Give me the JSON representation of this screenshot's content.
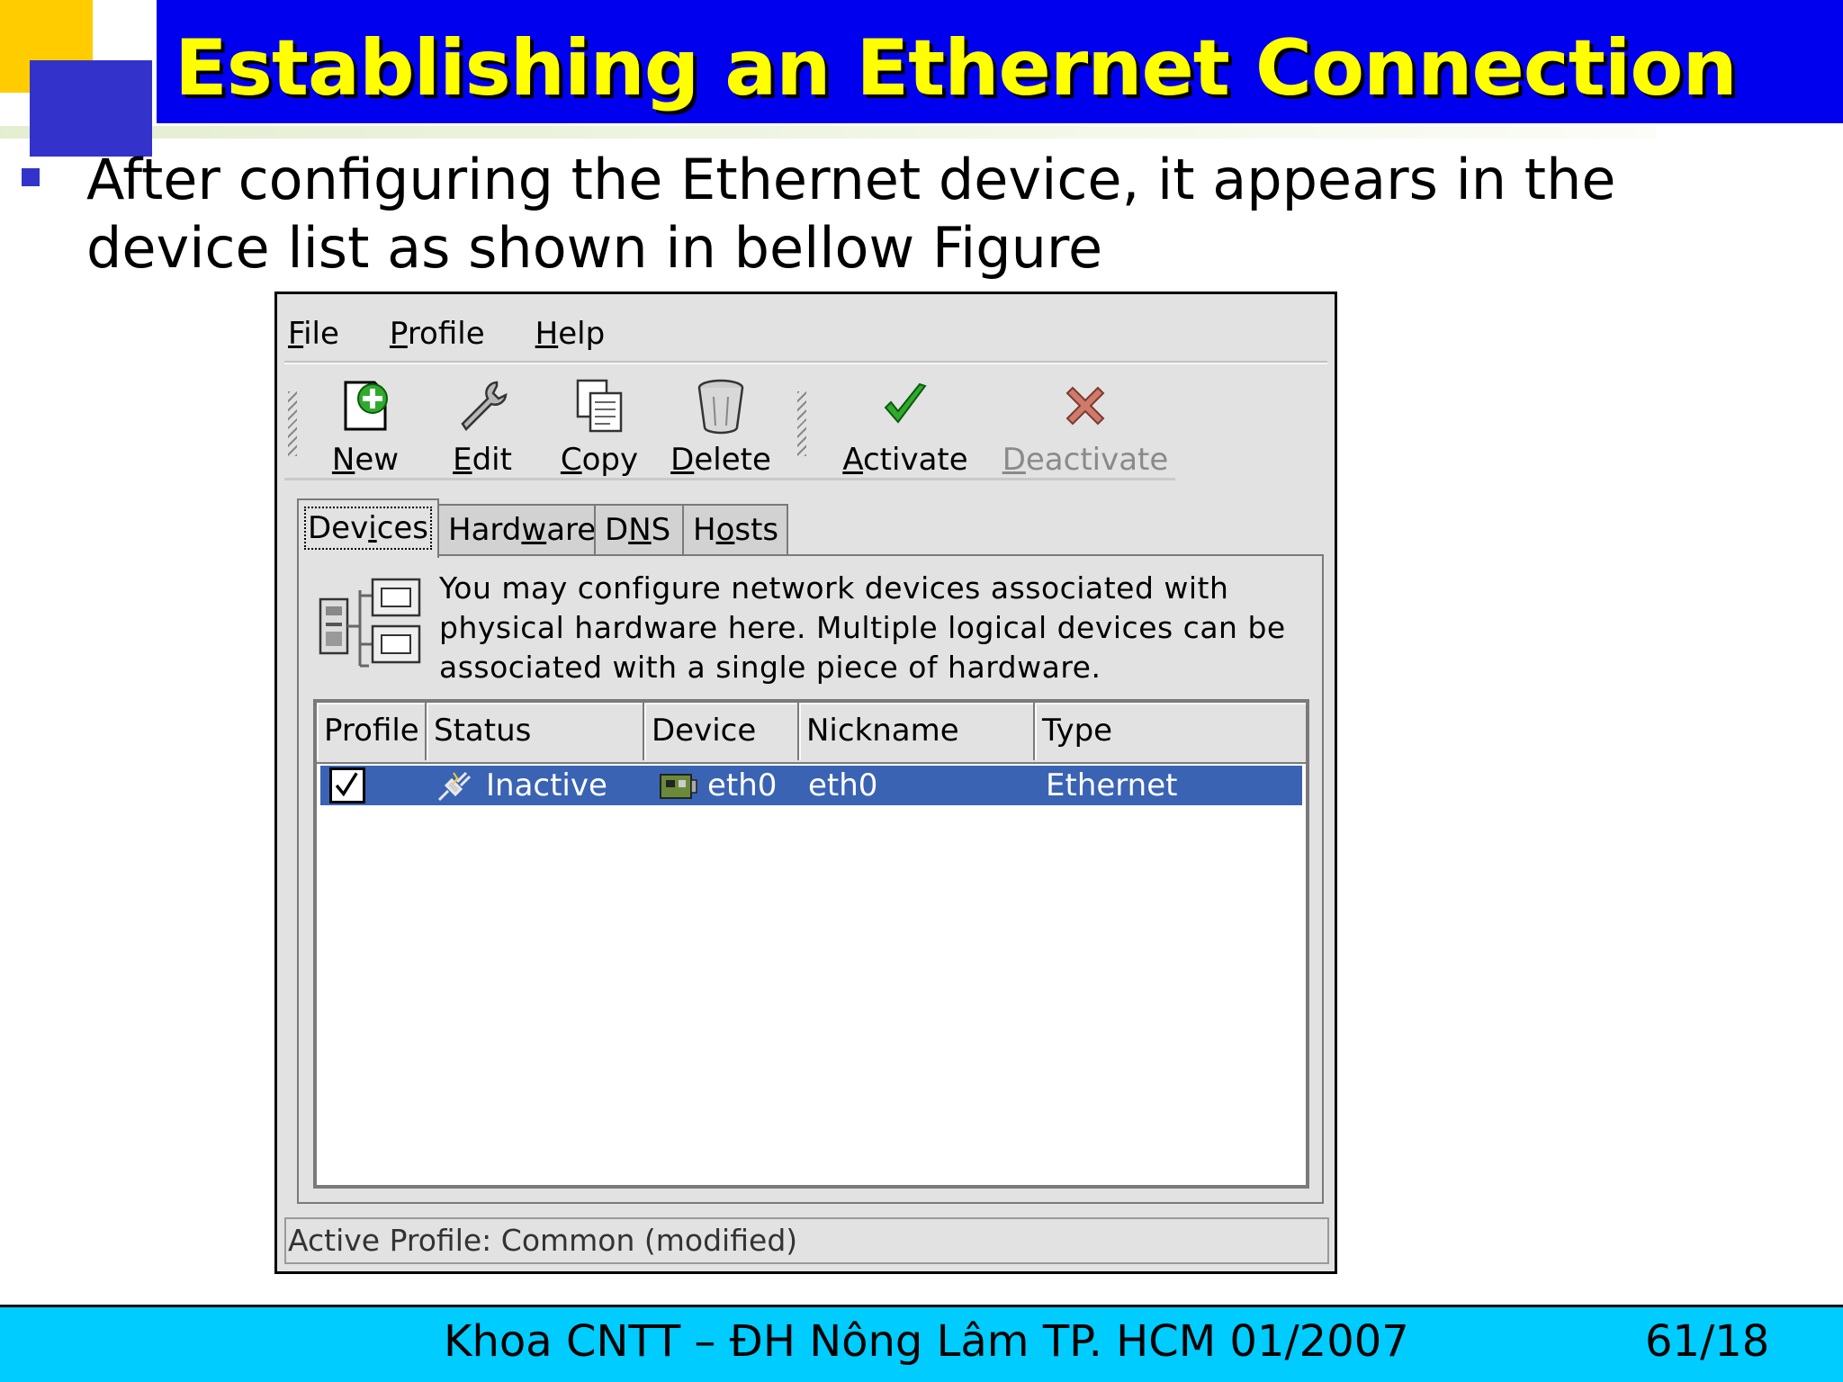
{
  "slide": {
    "title": "Establishing an Ethernet Connection",
    "bullet": "After configuring the Ethernet device, it appears in the device list as shown in bellow Figure",
    "footer": "Khoa CNTT – ĐH Nông Lâm TP. HCM 01/2007",
    "page": "61/18"
  },
  "window": {
    "menu": [
      {
        "first": "F",
        "rest": "ile"
      },
      {
        "first": "P",
        "rest": "rofile"
      },
      {
        "first": "H",
        "rest": "elp"
      }
    ],
    "toolbar": {
      "new": {
        "first": "N",
        "rest": "ew",
        "icon": "new-document-icon"
      },
      "edit": {
        "first": "E",
        "rest": "dit",
        "icon": "wrench-icon"
      },
      "copy": {
        "first": "C",
        "rest": "opy",
        "icon": "copy-icon"
      },
      "delete": {
        "first": "D",
        "rest": "elete",
        "icon": "trash-icon"
      },
      "activate": {
        "first": "A",
        "rest": "ctivate",
        "icon": "checkmark-icon"
      },
      "deactivate": {
        "first": "D",
        "rest": "eactivate",
        "icon": "cross-icon",
        "disabled": true
      }
    },
    "tabs": [
      {
        "a": "Dev",
        "u": "i",
        "b": "ces"
      },
      {
        "a": "Hard",
        "u": "w",
        "b": "are"
      },
      {
        "a": "D",
        "u": "N",
        "b": "S"
      },
      {
        "a": "H",
        "u": "o",
        "b": "sts"
      }
    ],
    "description": "You may configure network devices associated with physical hardware here.  Multiple logical devices can be associated with a single piece of hardware.",
    "columns": [
      "Profile",
      "Status",
      "Device",
      "Nickname",
      "Type"
    ],
    "rows": [
      {
        "profile_checked": true,
        "status": "Inactive",
        "device": "eth0",
        "nickname": "eth0",
        "type": "Ethernet"
      }
    ],
    "statusbar": "Active Profile: Common (modified)",
    "colors": {
      "selection": "#3a63b4",
      "title_bar": "#0000ee",
      "title_text": "#ffff00",
      "footer": "#00ccff"
    }
  }
}
